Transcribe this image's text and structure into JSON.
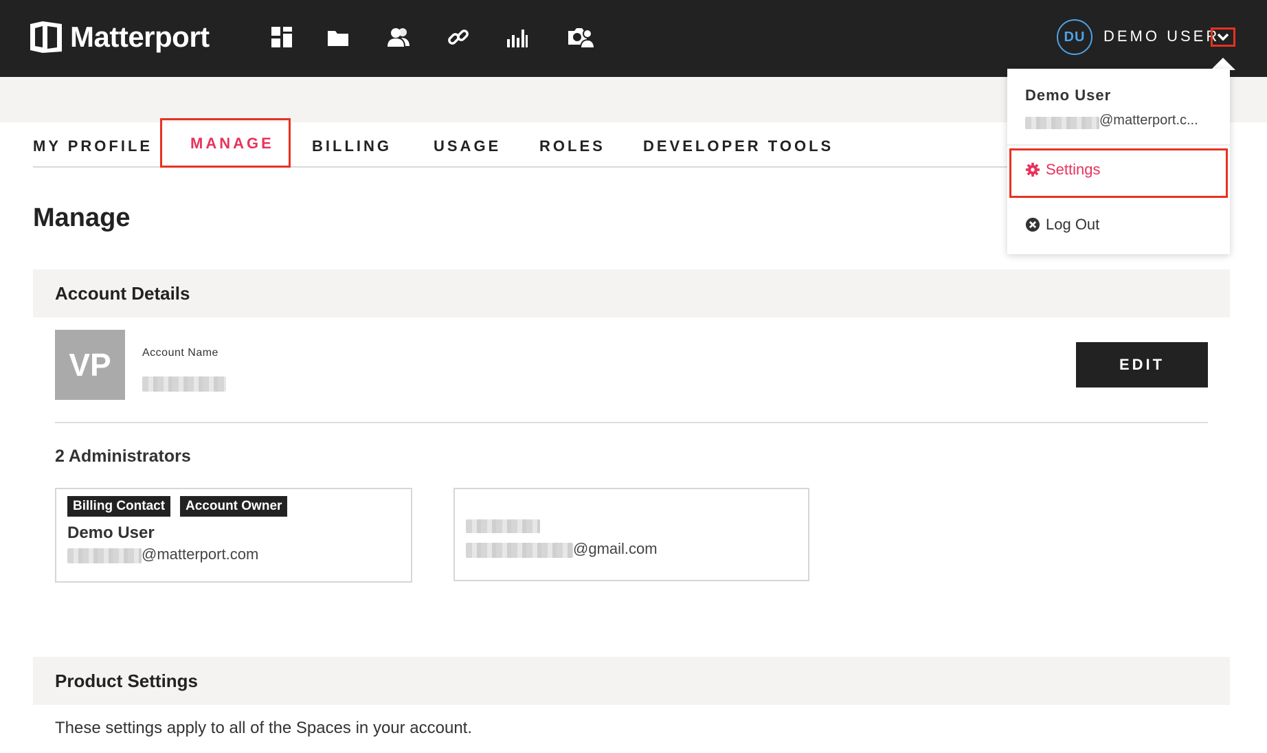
{
  "brand": {
    "name": "Matterport"
  },
  "nav_icons": [
    "dashboard-icon",
    "folder-icon",
    "users-icon",
    "link-icon",
    "analytics-icon",
    "photo-people-icon"
  ],
  "user": {
    "initials": "DU",
    "display_name": "DEMO USER"
  },
  "tabs": [
    {
      "label": "MY PROFILE",
      "active": false
    },
    {
      "label": "MANAGE",
      "active": true
    },
    {
      "label": "BILLING",
      "active": false
    },
    {
      "label": "USAGE",
      "active": false
    },
    {
      "label": "ROLES",
      "active": false
    },
    {
      "label": "DEVELOPER TOOLS",
      "active": false
    }
  ],
  "page": {
    "title": "Manage"
  },
  "account_details": {
    "heading": "Account Details",
    "avatar_initials": "VP",
    "account_name_label": "Account Name",
    "edit_label": "EDIT"
  },
  "administrators": {
    "title": "2 Administrators",
    "list": [
      {
        "tags": [
          "Billing Contact",
          "Account Owner"
        ],
        "name": "Demo User",
        "email_domain": "@matterport.com"
      },
      {
        "tags": [],
        "name": "",
        "email_domain": "@gmail.com"
      }
    ]
  },
  "product_settings": {
    "heading": "Product Settings",
    "description": "These settings apply to all of the Spaces in your account."
  },
  "dropdown": {
    "name": "Demo User",
    "email_domain": "@matterport.c...",
    "settings_label": "Settings",
    "logout_label": "Log Out"
  },
  "colors": {
    "topbar": "#222222",
    "accent": "#e8325c",
    "avatar_ring": "#4da3e6",
    "highlight_box": "#e8321f"
  }
}
